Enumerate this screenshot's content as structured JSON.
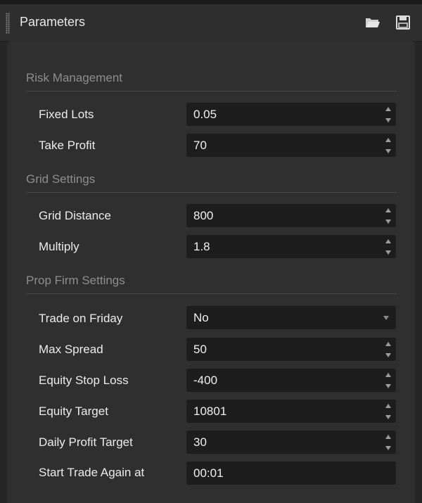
{
  "header": {
    "title": "Parameters",
    "icons": [
      "open-folder-icon",
      "save-icon"
    ]
  },
  "sections": [
    {
      "label": "Risk Management",
      "params": [
        {
          "label": "Fixed Lots",
          "value": "0.05",
          "control": "spinner"
        },
        {
          "label": "Take Profit",
          "value": "70",
          "control": "spinner"
        }
      ]
    },
    {
      "label": "Grid Settings",
      "params": [
        {
          "label": "Grid Distance",
          "value": "800",
          "control": "spinner"
        },
        {
          "label": "Multiply",
          "value": "1.8",
          "control": "spinner"
        }
      ]
    },
    {
      "label": "Prop Firm Settings",
      "params": [
        {
          "label": "Trade on Friday",
          "value": "No",
          "control": "dropdown"
        },
        {
          "label": "Max Spread",
          "value": "50",
          "control": "spinner"
        },
        {
          "label": "Equity Stop Loss",
          "value": "-400",
          "control": "spinner"
        },
        {
          "label": "Equity Target",
          "value": "10801",
          "control": "spinner"
        },
        {
          "label": "Daily Profit Target",
          "value": "30",
          "control": "spinner"
        },
        {
          "label": "Start Trade Again at",
          "value": "00:01",
          "control": "text"
        }
      ]
    }
  ]
}
